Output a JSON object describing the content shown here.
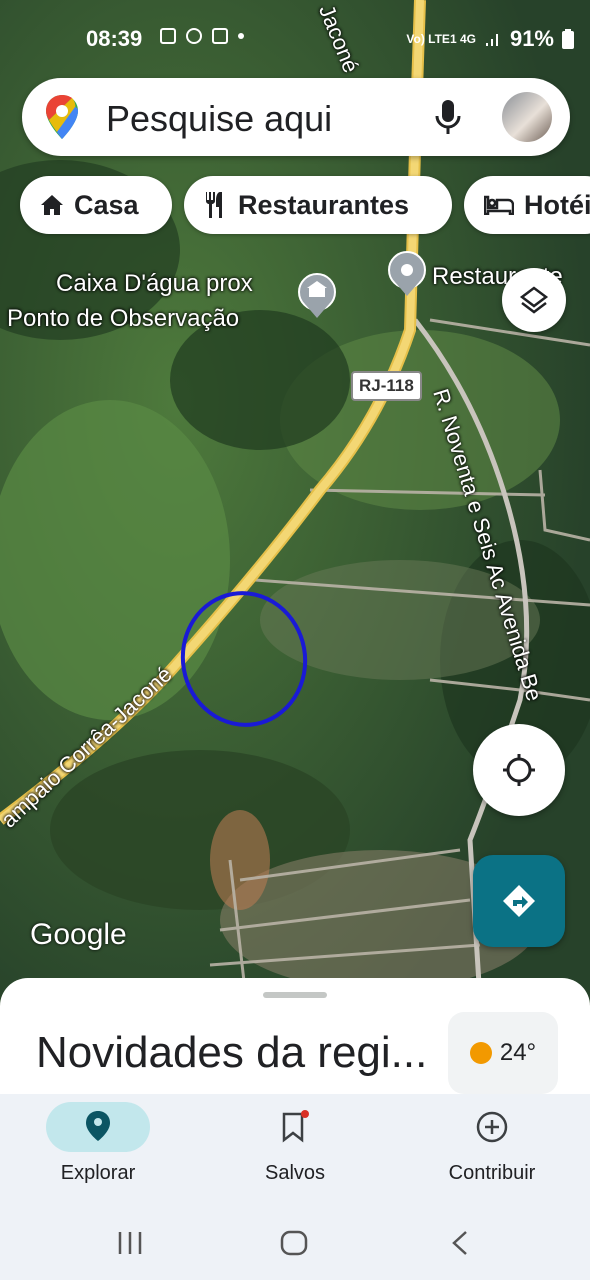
{
  "status_bar": {
    "time": "08:39",
    "network": "Vo) LTE1 4G",
    "battery": "91%"
  },
  "search": {
    "placeholder": "Pesquise aqui",
    "icons": [
      "maps-pin-icon",
      "mic-icon",
      "avatar"
    ]
  },
  "chips": [
    {
      "label": "Casa",
      "icon": "home-icon"
    },
    {
      "label": "Restaurantes",
      "icon": "restaurant-icon"
    },
    {
      "label": "Hotéi",
      "icon": "hotel-icon"
    }
  ],
  "map": {
    "places": {
      "caixa_line1": "Caixa D'água prox",
      "caixa_line2": "Ponto de Observação",
      "restaurante": "Restaurante"
    },
    "roads": {
      "rj118": "RJ-118",
      "sampaio": "ampaio Corrêa-Jaconé",
      "jacone_top": "Jaconé",
      "noventa": "R. Noventa e Seis Ac Avenida Be"
    },
    "attribution": "Google",
    "colors": {
      "road": "#f3d774",
      "annotation_circle": "#1a1ad6"
    }
  },
  "buttons": {
    "layers": "layers-icon",
    "my_location": "my-location-icon",
    "directions": "directions-icon"
  },
  "sheet": {
    "title": "Novidades da regi...",
    "weather": "24°"
  },
  "bottom_nav": [
    {
      "label": "Explorar",
      "icon": "explore-pin-icon",
      "active": true
    },
    {
      "label": "Salvos",
      "icon": "bookmark-icon",
      "active": false
    },
    {
      "label": "Contribuir",
      "icon": "add-circle-icon",
      "active": false
    }
  ],
  "accent_color": "#0b7285"
}
